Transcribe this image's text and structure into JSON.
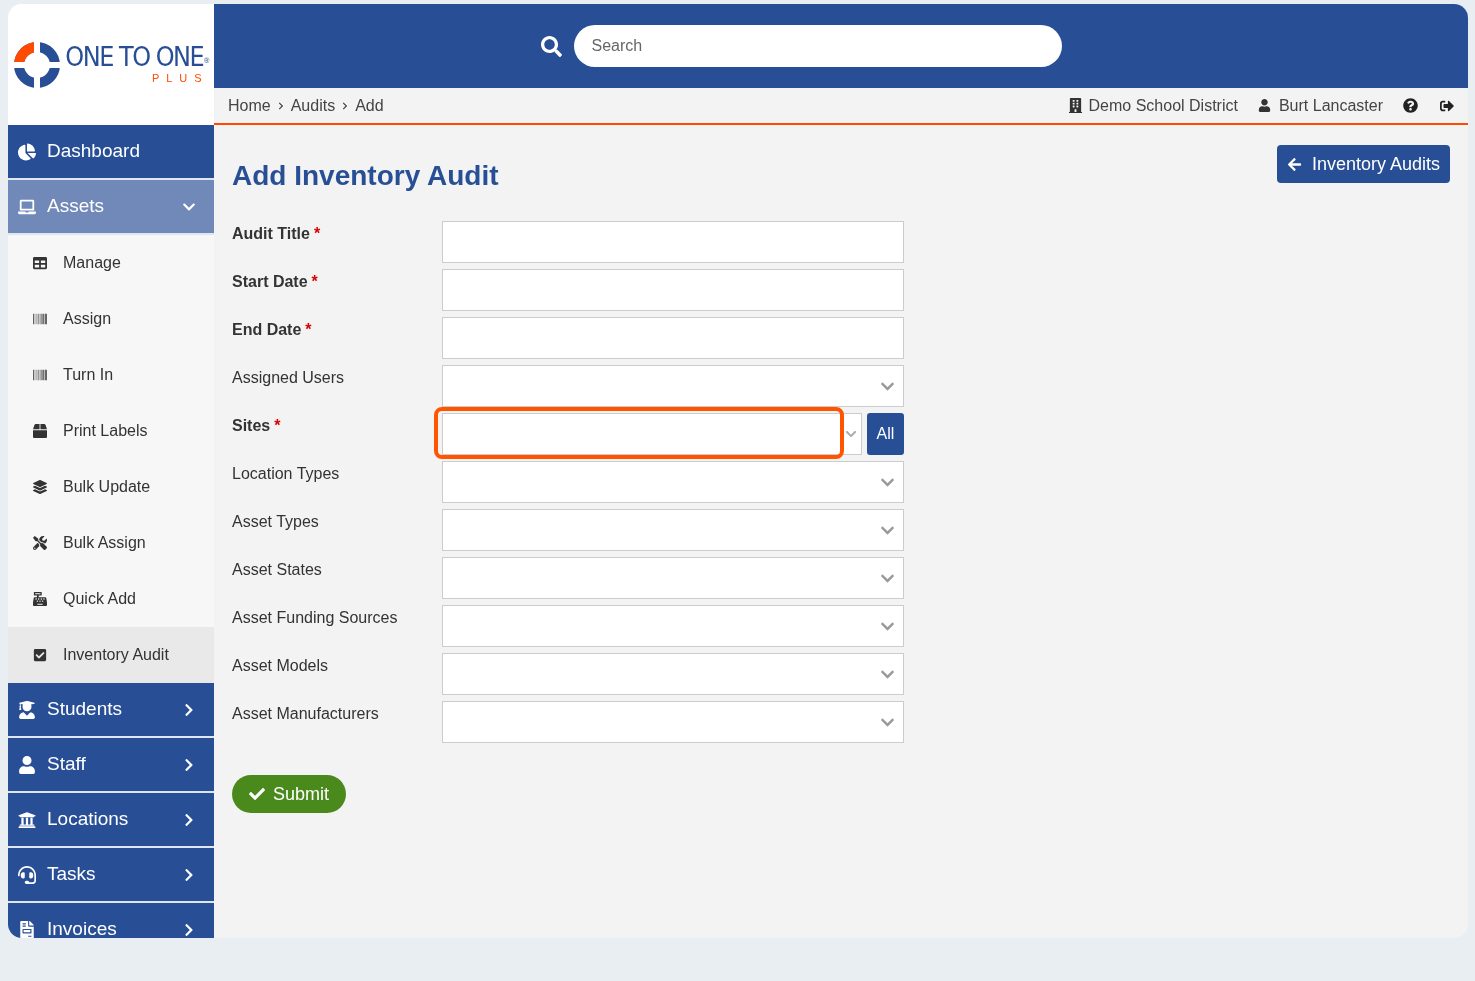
{
  "logo": {
    "name": "ONE TO ONE",
    "sub": "PLUS",
    "mark": "®"
  },
  "search": {
    "placeholder": "Search"
  },
  "breadcrumb": [
    "Home",
    "Audits",
    "Add"
  ],
  "header_right": {
    "district": "Demo School District",
    "user": "Burt Lancaster"
  },
  "sidebar": {
    "items": [
      {
        "label": "Dashboard",
        "expandable": false,
        "expanded": false
      },
      {
        "label": "Assets",
        "expandable": true,
        "expanded": true,
        "children": [
          {
            "label": "Manage",
            "selected": false
          },
          {
            "label": "Assign",
            "selected": false
          },
          {
            "label": "Turn In",
            "selected": false
          },
          {
            "label": "Print Labels",
            "selected": false
          },
          {
            "label": "Bulk Update",
            "selected": false
          },
          {
            "label": "Bulk Assign",
            "selected": false
          },
          {
            "label": "Quick Add",
            "selected": false
          },
          {
            "label": "Inventory Audit",
            "selected": true
          }
        ]
      },
      {
        "label": "Students",
        "expandable": true,
        "expanded": false
      },
      {
        "label": "Staff",
        "expandable": true,
        "expanded": false
      },
      {
        "label": "Locations",
        "expandable": true,
        "expanded": false
      },
      {
        "label": "Tasks",
        "expandable": true,
        "expanded": false
      },
      {
        "label": "Invoices",
        "expandable": true,
        "expanded": false
      }
    ]
  },
  "page_title": "Add Inventory Audit",
  "back_button": "Inventory Audits",
  "form": {
    "fields": [
      {
        "label": "Audit Title",
        "required": true,
        "kind": "text",
        "highlighted": false
      },
      {
        "label": "Start Date",
        "required": true,
        "kind": "text",
        "highlighted": false
      },
      {
        "label": "End Date",
        "required": true,
        "kind": "text",
        "highlighted": false
      },
      {
        "label": "Assigned Users",
        "required": false,
        "kind": "select",
        "highlighted": false
      },
      {
        "label": "Sites",
        "required": true,
        "kind": "select_all",
        "button": "All",
        "highlighted": true
      },
      {
        "label": "Location Types",
        "required": false,
        "kind": "select",
        "highlighted": false
      },
      {
        "label": "Asset Types",
        "required": false,
        "kind": "select",
        "highlighted": false
      },
      {
        "label": "Asset States",
        "required": false,
        "kind": "select",
        "highlighted": false
      },
      {
        "label": "Asset Funding Sources",
        "required": false,
        "kind": "select",
        "highlighted": false
      },
      {
        "label": "Asset Models",
        "required": false,
        "kind": "select",
        "highlighted": false
      },
      {
        "label": "Asset Manufacturers",
        "required": false,
        "kind": "select",
        "highlighted": false
      }
    ],
    "required_mark": "*",
    "submit": "Submit"
  }
}
